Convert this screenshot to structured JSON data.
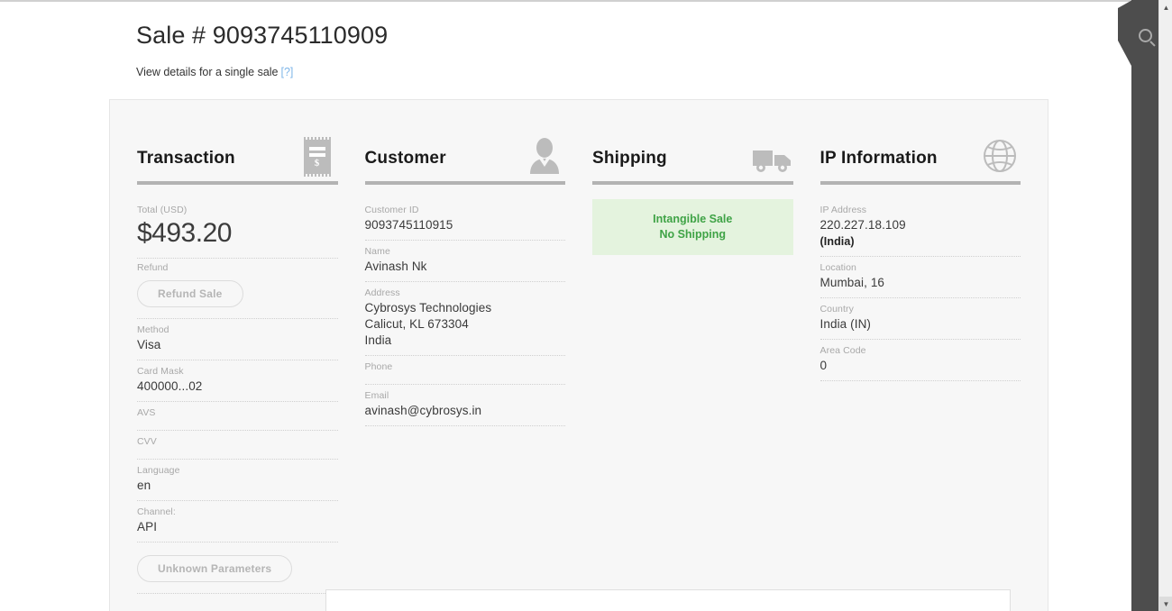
{
  "page": {
    "title": "Sale # 9093745110909",
    "subtitle": "View details for a single sale",
    "help_link": "[?]",
    "help_link_color": "#7fb6e8"
  },
  "sections": {
    "transaction": {
      "title": "Transaction",
      "icon": "receipt-dollar-icon",
      "fields": [
        {
          "label": "Total (USD)",
          "value": "$493.20"
        },
        {
          "label": "Refund",
          "value": ""
        },
        {
          "label": "Method",
          "value": "Visa"
        },
        {
          "label": "Card Mask",
          "value": "400000...02"
        },
        {
          "label": "AVS",
          "value": ""
        },
        {
          "label": "CVV",
          "value": ""
        },
        {
          "label": "Language",
          "value": "en"
        },
        {
          "label": "Channel:",
          "value": "API"
        }
      ],
      "refund_button": "Refund Sale",
      "unknown_params_button": "Unknown Parameters"
    },
    "customer": {
      "title": "Customer",
      "icon": "person-avatar-icon",
      "fields": [
        {
          "label": "Customer ID",
          "value": "9093745110915"
        },
        {
          "label": "Name",
          "value": "Avinash Nk"
        },
        {
          "label": "Address",
          "value": "Cybrosys Technologies\nCalicut, KL 673304\nIndia"
        },
        {
          "label": "Phone",
          "value": ""
        },
        {
          "label": "Email",
          "value": "avinash@cybrosys.in"
        }
      ]
    },
    "shipping": {
      "title": "Shipping",
      "icon": "delivery-truck-icon",
      "notice_line1": "Intangible Sale",
      "notice_line2": "No Shipping",
      "notice_bg": "#e4f3de",
      "notice_color": "#3fa346"
    },
    "ip_information": {
      "title": "IP Information",
      "icon": "globe-icon",
      "fields": [
        {
          "label": "IP Address",
          "value": "220.227.18.109",
          "value2": "(India)"
        },
        {
          "label": "Location",
          "value": "Mumbai, 16"
        },
        {
          "label": "Country",
          "value": "India (IN)"
        },
        {
          "label": "Area Code",
          "value": "0"
        }
      ]
    }
  },
  "chrome": {
    "search_icon": "search-icon",
    "scroll_up": "▲",
    "scroll_down": "▼"
  }
}
